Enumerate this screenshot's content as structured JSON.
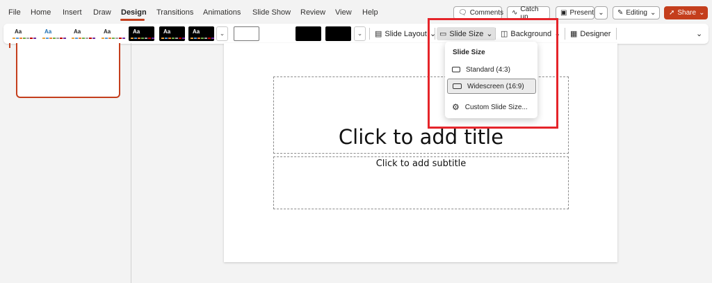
{
  "menu": {
    "file": "File",
    "home": "Home",
    "insert": "Insert",
    "draw": "Draw",
    "design": "Design",
    "transitions": "Transitions",
    "animations": "Animations",
    "slideshow": "Slide Show",
    "review": "Review",
    "view": "View",
    "help": "Help"
  },
  "top_actions": {
    "comments": "Comments",
    "catchup": "Catch up",
    "present": "Present",
    "editing": "Editing",
    "share": "Share"
  },
  "themes": [
    {
      "aa": "Aa",
      "bg": "#ffffff",
      "fg": "#222222"
    },
    {
      "aa": "Aa",
      "bg": "#ffffff",
      "fg": "#1f6fb2"
    },
    {
      "aa": "Aa",
      "bg": "#ffffff",
      "fg": "#222222"
    },
    {
      "aa": "Aa",
      "bg": "#ffffff",
      "fg": "#222222"
    },
    {
      "aa": "Aa",
      "bg": "#000000",
      "fg": "#ffffff"
    },
    {
      "aa": "Aa",
      "bg": "#000000",
      "fg": "#ffffff"
    },
    {
      "aa": "Aa",
      "bg": "#000000",
      "fg": "#ffffff"
    }
  ],
  "ribbon": {
    "slide_layout": "Slide Layout",
    "slide_size": "Slide Size",
    "background": "Background",
    "designer": "Designer"
  },
  "slide_size_menu": {
    "header": "Slide Size",
    "standard": "Standard (4:3)",
    "widescreen": "Widescreen (16:9)",
    "custom": "Custom Slide Size..."
  },
  "slide": {
    "title_placeholder": "Click to add title",
    "subtitle_placeholder": "Click to add subtitle"
  },
  "colors": {
    "accent": "#c43e1c",
    "highlight": "#e5242a"
  }
}
